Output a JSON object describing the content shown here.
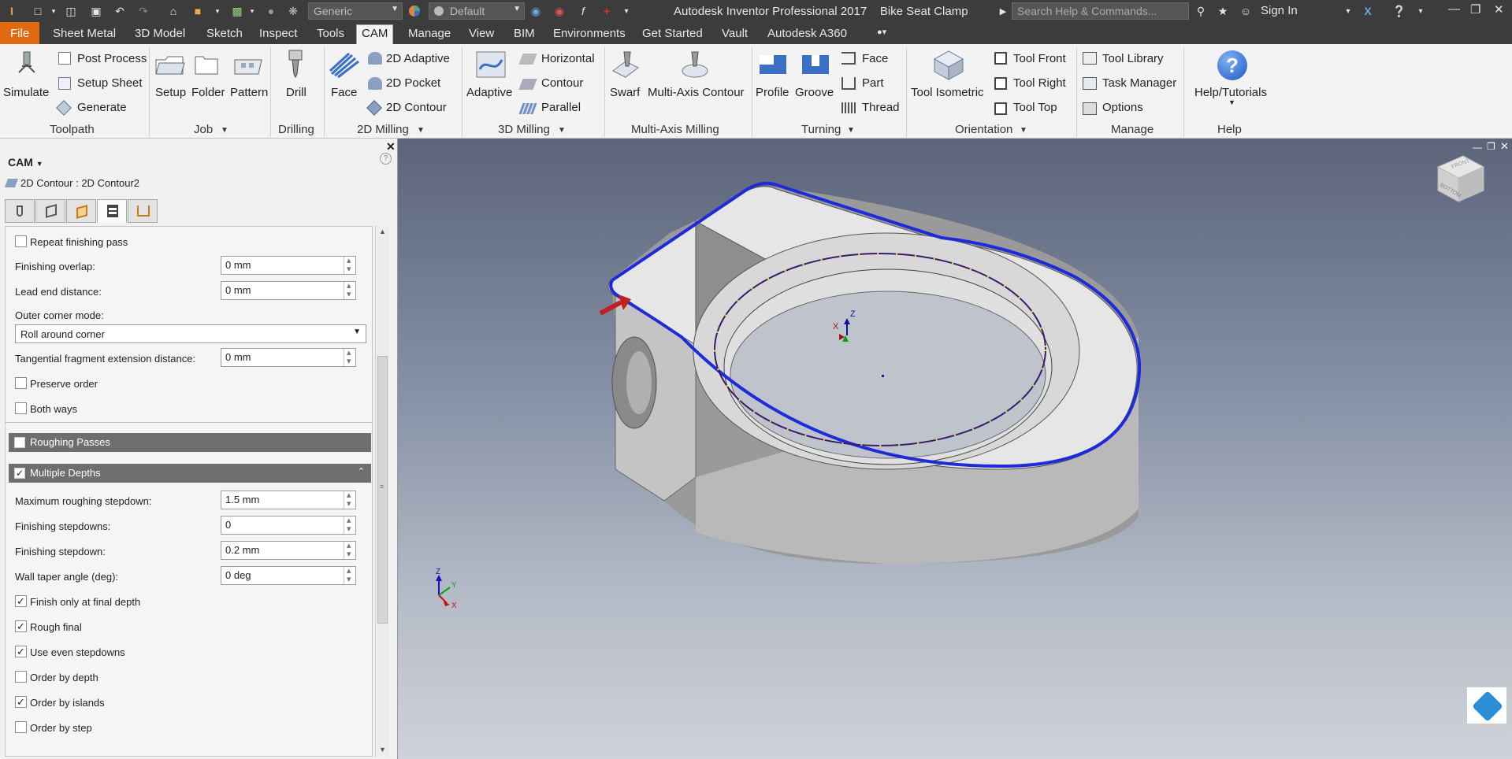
{
  "app": {
    "title": "Autodesk Inventor Professional 2017",
    "document": "Bike Seat Clamp",
    "search_placeholder": "Search Help & Commands...",
    "signin_label": "Sign In",
    "material_combo": "Generic",
    "appearance_combo": "Default"
  },
  "tabs": [
    "File",
    "Sheet Metal",
    "3D Model",
    "Sketch",
    "Inspect",
    "Tools",
    "CAM",
    "Manage",
    "View",
    "BIM",
    "Environments",
    "Get Started",
    "Vault",
    "Autodesk A360"
  ],
  "active_tab": "CAM",
  "ribbon": {
    "toolpath": {
      "label": "Toolpath",
      "simulate": "Simulate",
      "post_process": "Post Process",
      "setup_sheet": "Setup Sheet",
      "generate": "Generate"
    },
    "job": {
      "label": "Job",
      "setup": "Setup",
      "folder": "Folder",
      "pattern": "Pattern"
    },
    "drilling": {
      "label": "Drilling",
      "drill": "Drill"
    },
    "milling2d": {
      "label": "2D Milling",
      "face": "Face",
      "adaptive2d": "2D Adaptive",
      "pocket2d": "2D Pocket",
      "contour2d": "2D Contour"
    },
    "milling3d": {
      "label": "3D Milling",
      "adaptive": "Adaptive",
      "horizontal": "Horizontal",
      "contour": "Contour",
      "parallel": "Parallel"
    },
    "multiaxis": {
      "label": "Multi-Axis Milling",
      "swarf": "Swarf",
      "multi_axis_contour": "Multi-Axis Contour"
    },
    "turning": {
      "label": "Turning",
      "profile": "Profile",
      "groove": "Groove",
      "face": "Face",
      "part": "Part",
      "thread": "Thread"
    },
    "orientation": {
      "label": "Orientation",
      "tool_isometric": "Tool Isometric",
      "tool_front": "Tool Front",
      "tool_right": "Tool Right",
      "tool_top": "Tool Top"
    },
    "manage": {
      "label": "Manage",
      "tool_library": "Tool Library",
      "task_manager": "Task Manager",
      "options": "Options"
    },
    "help": {
      "label": "Help",
      "help_tutorials": "Help/Tutorials"
    }
  },
  "panel": {
    "title": "CAM",
    "operation_path": "2D Contour : 2D Contour2",
    "fields": {
      "repeat_finishing_pass": {
        "label": "Repeat finishing pass",
        "checked": false
      },
      "finishing_overlap": {
        "label": "Finishing overlap:",
        "value": "0 mm"
      },
      "lead_end_distance": {
        "label": "Lead end distance:",
        "value": "0 mm"
      },
      "outer_corner_mode": {
        "label": "Outer corner mode:",
        "value": "Roll around corner"
      },
      "tangential_fragment": {
        "label": "Tangential fragment extension distance:",
        "value": "0 mm"
      },
      "preserve_order": {
        "label": "Preserve order",
        "checked": false
      },
      "both_ways": {
        "label": "Both ways",
        "checked": false
      },
      "roughing_passes": {
        "label": "Roughing Passes",
        "checked": false
      },
      "multiple_depths": {
        "label": "Multiple Depths",
        "checked": true
      },
      "max_roughing_stepdown": {
        "label": "Maximum roughing stepdown:",
        "value": "1.5 mm"
      },
      "finishing_stepdowns": {
        "label": "Finishing stepdowns:",
        "value": "0"
      },
      "finishing_stepdown": {
        "label": "Finishing stepdown:",
        "value": "0.2 mm"
      },
      "wall_taper_angle": {
        "label": "Wall taper angle (deg):",
        "value": "0 deg"
      },
      "finish_only_final_depth": {
        "label": "Finish only at final depth",
        "checked": true
      },
      "rough_final": {
        "label": "Rough final",
        "checked": true
      },
      "use_even_stepdowns": {
        "label": "Use even stepdowns",
        "checked": true
      },
      "order_by_depth": {
        "label": "Order by depth",
        "checked": false
      },
      "order_by_islands": {
        "label": "Order by islands",
        "checked": true
      },
      "order_by_step": {
        "label": "Order by step",
        "checked": false
      }
    }
  },
  "viewport": {
    "triad_labels": {
      "z": "Z",
      "x": "X",
      "y": "Y"
    },
    "view_cube_labels": {
      "front": "FRONT",
      "bottom": "BOTTOM"
    }
  },
  "colors": {
    "accent_file_tab": "#e06a0f",
    "toolpath_blue": "#1d2bd8",
    "section_header": "#6e6e6e"
  }
}
